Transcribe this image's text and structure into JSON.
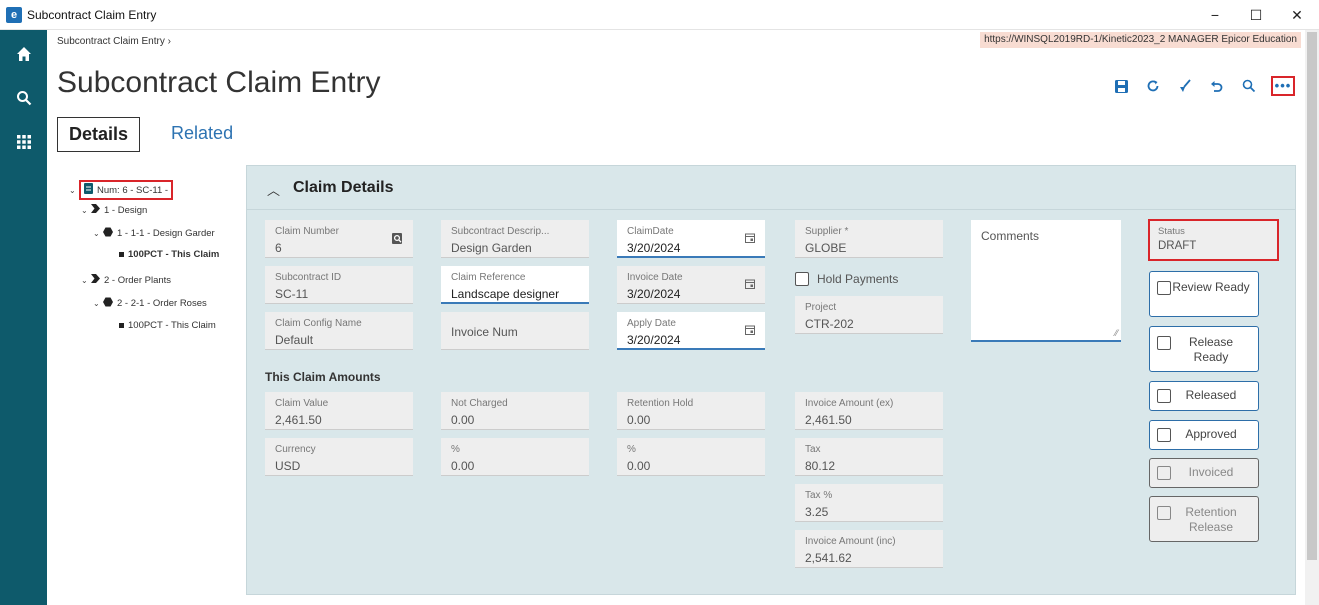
{
  "window": {
    "title": "Subcontract Claim Entry",
    "minimize": "−",
    "maximize": "☐",
    "close": "✕"
  },
  "breadcrumb": "Subcontract Claim Entry  ›",
  "server_info": "https://WINSQL2019RD-1/Kinetic2023_2  MANAGER  Epicor Education",
  "page_title": "Subcontract Claim Entry",
  "tabs": {
    "details": "Details",
    "related": "Related"
  },
  "toolbar": {
    "more": "•••"
  },
  "tree": {
    "root": "Num: 6 - SC-11 -",
    "n1": "1 - Design",
    "n1a": "1 - 1-1 - Design Garder",
    "n1a_leaf": "100PCT - This Claim",
    "n2": "2 - Order Plants",
    "n2a": "2 - 2-1 - Order Roses",
    "n2a_leaf": "100PCT - This Claim"
  },
  "panel": {
    "title": "Claim Details",
    "claim_number": {
      "label": "Claim Number",
      "value": "6"
    },
    "subcontract_id": {
      "label": "Subcontract ID",
      "value": "SC-11"
    },
    "claim_config": {
      "label": "Claim Config Name",
      "value": "Default"
    },
    "subcontract_desc": {
      "label": "Subcontract Descrip...",
      "value": "Design Garden"
    },
    "claim_reference": {
      "label": "Claim Reference",
      "value": "Landscape designer"
    },
    "invoice_num": {
      "placeholder": "Invoice Num"
    },
    "claim_date": {
      "label": "ClaimDate",
      "value": "3/20/2024"
    },
    "invoice_date": {
      "label": "Invoice Date",
      "value": "3/20/2024"
    },
    "apply_date": {
      "label": "Apply Date",
      "value": "3/20/2024"
    },
    "supplier": {
      "label": "Supplier *",
      "value": "GLOBE"
    },
    "hold_payments": "Hold Payments",
    "project": {
      "label": "Project",
      "value": "CTR-202"
    },
    "comments": {
      "placeholder": "Comments"
    },
    "status": {
      "label": "Status",
      "value": "DRAFT"
    },
    "flags": {
      "review_ready": "Review Ready",
      "release_ready": "Release Ready",
      "released": "Released",
      "approved": "Approved",
      "invoiced": "Invoiced",
      "retention_release": "Retention Release"
    },
    "amounts_title": "This Claim Amounts",
    "claim_value": {
      "label": "Claim Value",
      "value": "2,461.50"
    },
    "currency": {
      "label": "Currency",
      "value": "USD"
    },
    "not_charged": {
      "label": "Not Charged",
      "value": "0.00"
    },
    "not_charged_pct": {
      "label": "%",
      "value": "0.00"
    },
    "retention_hold": {
      "label": "Retention Hold",
      "value": "0.00"
    },
    "retention_pct": {
      "label": "%",
      "value": "0.00"
    },
    "invoice_amount_ex": {
      "label": "Invoice Amount (ex)",
      "value": "2,461.50"
    },
    "tax": {
      "label": "Tax",
      "value": "80.12"
    },
    "tax_pct": {
      "label": "Tax %",
      "value": "3.25"
    },
    "invoice_amount_inc": {
      "label": "Invoice Amount (inc)",
      "value": "2,541.62"
    }
  },
  "colors": {
    "sidebar": "#0e5a6b",
    "accent": "#1f6fb5",
    "panel_bg": "#d9e7ea",
    "highlight_red": "#d9252a"
  },
  "icons": {
    "sidebar": [
      "home-icon",
      "search-icon",
      "apps-grid-icon"
    ],
    "toolbar": [
      "save-icon",
      "refresh-icon",
      "clear-icon",
      "undo-icon",
      "search-icon",
      "more-options-icon"
    ]
  }
}
